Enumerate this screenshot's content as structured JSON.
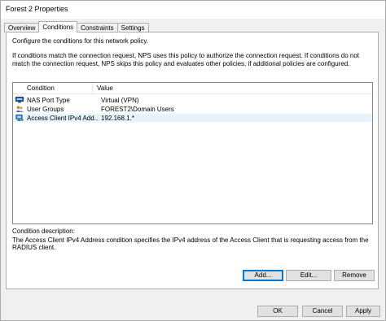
{
  "window": {
    "title": "Forest 2 Properties"
  },
  "tabs": [
    {
      "label": "Overview"
    },
    {
      "label": "Conditions"
    },
    {
      "label": "Constraints"
    },
    {
      "label": "Settings"
    }
  ],
  "conditions": {
    "intro": "Configure the conditions for this network policy.",
    "explanation": "If conditions match the connection request, NPS uses this policy to authorize the connection request. If conditions do not match the connection request, NPS skips this policy and evaluates other policies, if additional policies are configured.",
    "columns": {
      "condition": "Condition",
      "value": "Value"
    },
    "rows": [
      {
        "condition": "NAS Port Type",
        "value": "Virtual (VPN)",
        "icon": "nas-port-icon"
      },
      {
        "condition": "User Groups",
        "value": "FOREST2\\Domain Users",
        "icon": "user-groups-icon"
      },
      {
        "condition": "Access Client IPv4 Add...",
        "value": "192.168.1.*",
        "icon": "network-client-icon"
      }
    ],
    "description_label": "Condition description:",
    "description_text": "The Access Client IPv4 Address condition specifies the IPv4 address of the Access Client that is requesting access from the RADIUS client.",
    "buttons": {
      "add": "Add...",
      "edit": "Edit...",
      "remove": "Remove"
    }
  },
  "footer": {
    "ok": "OK",
    "cancel": "Cancel",
    "apply": "Apply"
  },
  "colors": {
    "selection": "#e5f3fb",
    "focus": "#0078d7",
    "dialog_bg": "#f0f0f0"
  }
}
